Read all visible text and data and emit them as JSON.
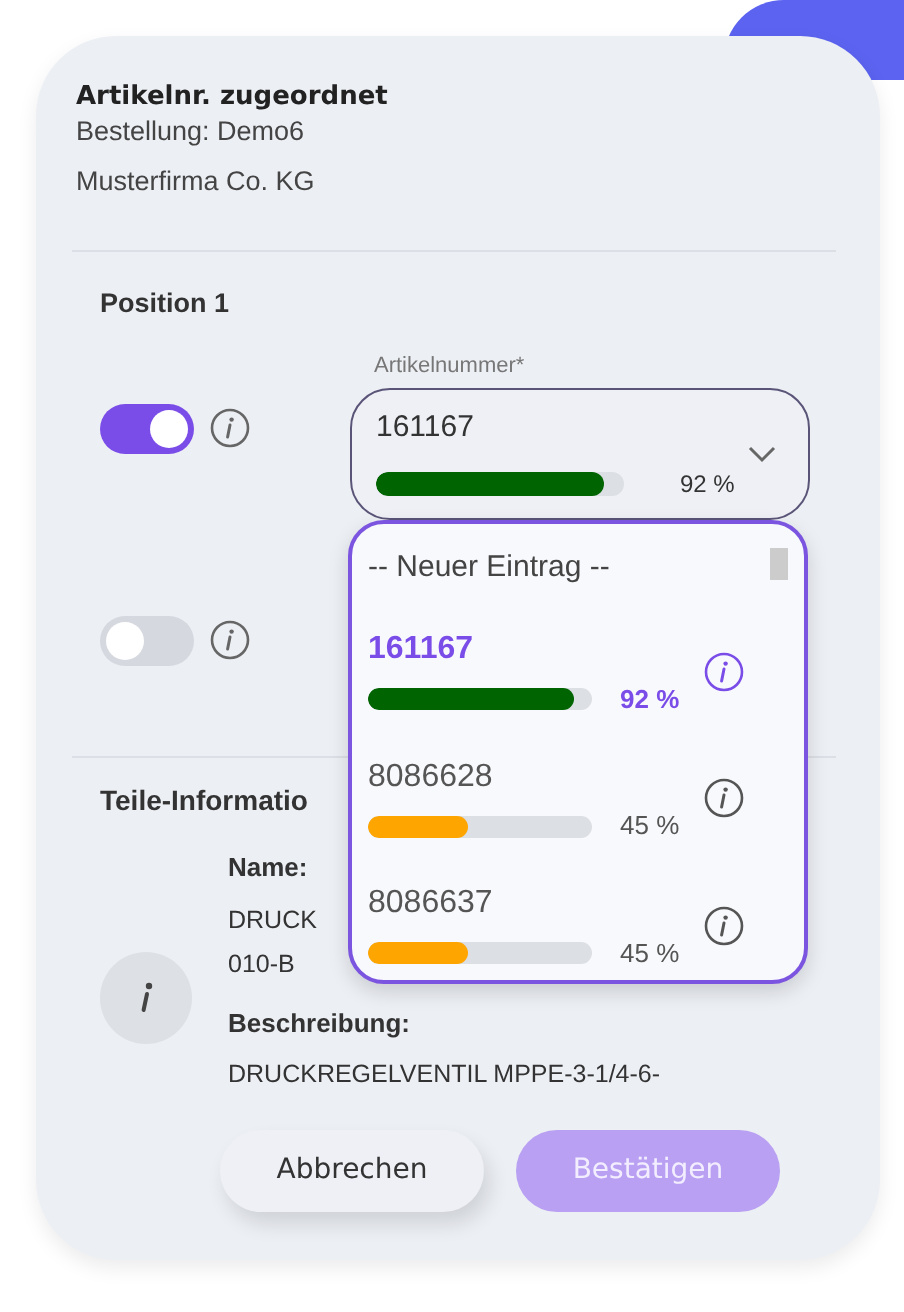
{
  "dialog": {
    "title": "Artikelnr. zugeordnet",
    "subtitle": "Bestellung: Demo6",
    "company": "Musterfirma Co. KG"
  },
  "position": {
    "title": "Position 1",
    "rows": [
      {
        "on": true,
        "field": {
          "label": "Artikelnummer*",
          "value": "161167",
          "level": 0.92,
          "reading": "92 %"
        }
      },
      {
        "on": false
      }
    ]
  },
  "dropdown": {
    "items": [
      {
        "kind": "header",
        "text": "-- Neuer Eintrag --"
      },
      {
        "kind": "option",
        "text": "161167",
        "level": 0.92,
        "reading": "92 %",
        "color": "#006400",
        "selected": true
      },
      {
        "kind": "option",
        "text": "8086628",
        "level": 0.45,
        "reading": "45 %",
        "color": "#ffa500",
        "selected": false
      },
      {
        "kind": "option",
        "text": "8086637",
        "level": 0.45,
        "reading": "45 %",
        "color": "#ffa500",
        "selected": false
      }
    ]
  },
  "parts_info": {
    "title": "Teile-Informatio",
    "name_label": "Name:",
    "name_lines": [
      "DRUCK",
      "010-B"
    ],
    "desc_label": "Beschreibung:",
    "desc": "DRUCKREGELVENTIL MPPE-3-1/4-6-"
  },
  "buttons": [
    {
      "label": "Abbrechen",
      "kind": "secondary",
      "disabled": false
    },
    {
      "label": "Bestätigen",
      "kind": "primary",
      "disabled": true
    }
  ]
}
